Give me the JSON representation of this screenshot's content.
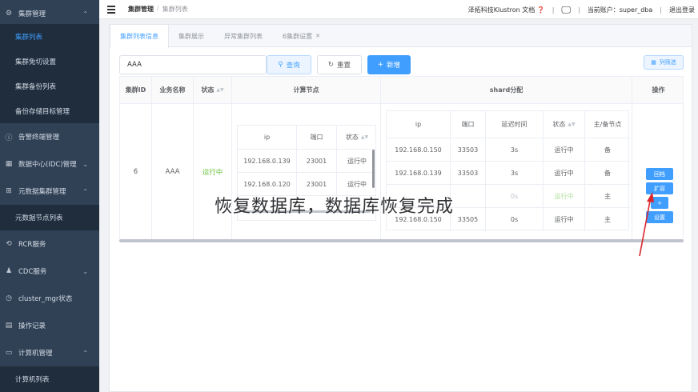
{
  "sidebar": {
    "group1": "集群管理",
    "items": [
      "集群列表",
      "集群免切设置",
      "集群备份列表",
      "备份存储目标管理"
    ],
    "alarm": "告警终端管理",
    "idc": "数据中心(IDC)管理",
    "meta": "元数据集群管理",
    "meta_item": "元数据节点列表",
    "rcr": "RCR服务",
    "cdc": "CDC服务",
    "mgr": "cluster_mgr状态",
    "log": "操作记录",
    "computer": "计算机管理",
    "computer_item": "计算机列表"
  },
  "navbar": {
    "breadcrumb": [
      "集群管理",
      "集群列表"
    ],
    "docs": "泽拓科技Klustron 文档",
    "account": "当前账户：super_dba",
    "logout": "退出登录"
  },
  "tabs": [
    "集群列表信息",
    "集群展示",
    "异常集群列表",
    "6集群设置"
  ],
  "search": {
    "value": "AAA",
    "query": "查询",
    "reset": "重置",
    "add": "新增",
    "columns": "列筛选"
  },
  "table": {
    "headers": {
      "id": "集群ID",
      "name": "业务名称",
      "status": "状态",
      "compute": "计算节点",
      "shard": "shard分配",
      "op": "操作"
    },
    "row": {
      "id": "6",
      "name": "AAA",
      "status": "运行中"
    },
    "compute_headers": [
      "ip",
      "端口",
      "状态"
    ],
    "compute_rows": [
      [
        "192.168.0.139",
        "23001",
        "运行中"
      ],
      [
        "192.168.0.120",
        "23001",
        "运行中"
      ]
    ],
    "shard_headers": [
      "ip",
      "端口",
      "延迟时间",
      "状态",
      "主/备节点"
    ],
    "shard_rows": [
      [
        "192.168.0.150",
        "33503",
        "3s",
        "运行中",
        "备"
      ],
      [
        "192.168.0.139",
        "33503",
        "3s",
        "运行中",
        "备"
      ],
      [
        "",
        "",
        "0s",
        "运行中",
        "主"
      ],
      [
        "192.168.0.150",
        "33505",
        "0s",
        "运行中",
        "主"
      ]
    ],
    "ops": [
      "回档",
      "扩容",
      "+",
      "设置"
    ]
  },
  "overlay": "恢复数据库，数据库恢复完成",
  "colors": {
    "sidebar": "#304156",
    "accent": "#409eff",
    "running": "#67c23a",
    "annotation": "#d9262c"
  }
}
